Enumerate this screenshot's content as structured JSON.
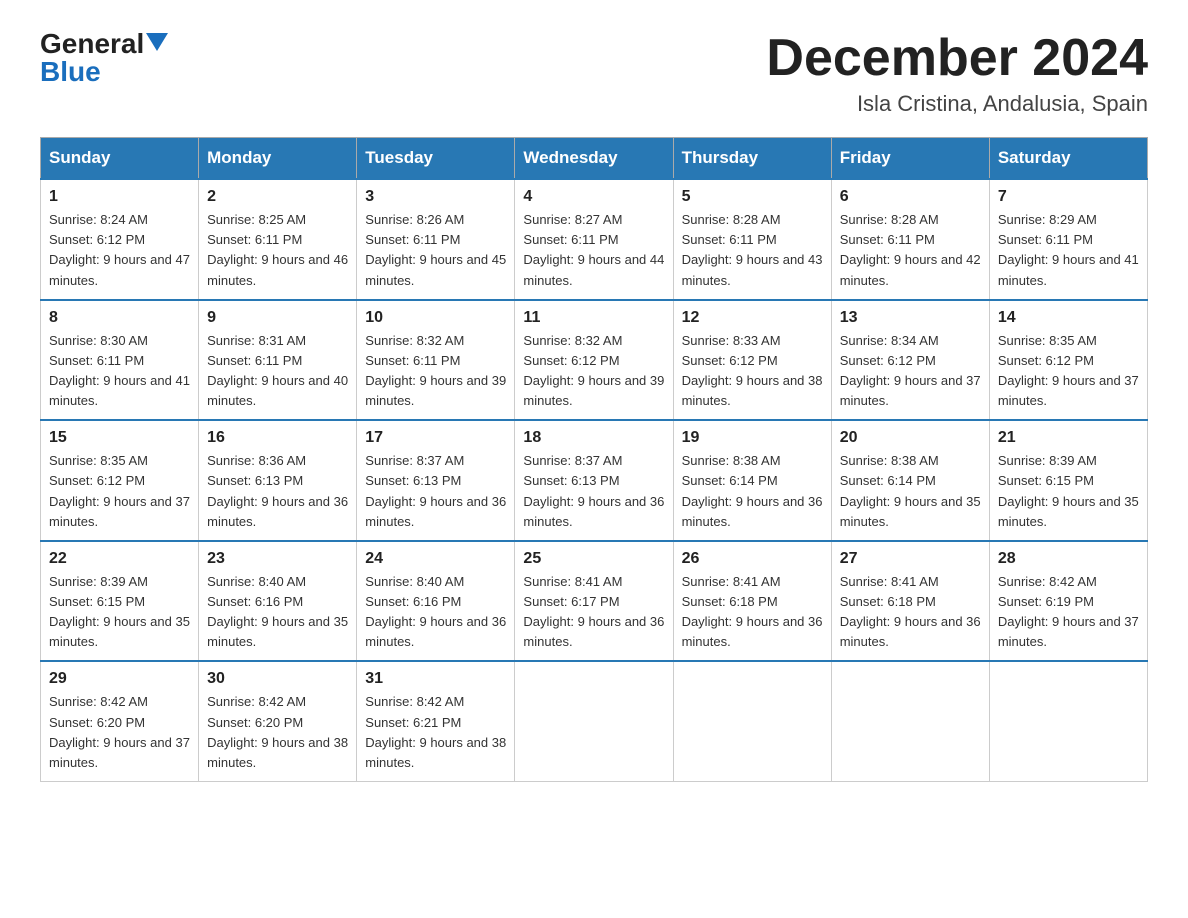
{
  "header": {
    "logo_general": "General",
    "logo_blue": "Blue",
    "month_title": "December 2024",
    "subtitle": "Isla Cristina, Andalusia, Spain"
  },
  "days_of_week": [
    "Sunday",
    "Monday",
    "Tuesday",
    "Wednesday",
    "Thursday",
    "Friday",
    "Saturday"
  ],
  "weeks": [
    [
      {
        "day": "1",
        "sunrise": "8:24 AM",
        "sunset": "6:12 PM",
        "daylight": "9 hours and 47 minutes."
      },
      {
        "day": "2",
        "sunrise": "8:25 AM",
        "sunset": "6:11 PM",
        "daylight": "9 hours and 46 minutes."
      },
      {
        "day": "3",
        "sunrise": "8:26 AM",
        "sunset": "6:11 PM",
        "daylight": "9 hours and 45 minutes."
      },
      {
        "day": "4",
        "sunrise": "8:27 AM",
        "sunset": "6:11 PM",
        "daylight": "9 hours and 44 minutes."
      },
      {
        "day": "5",
        "sunrise": "8:28 AM",
        "sunset": "6:11 PM",
        "daylight": "9 hours and 43 minutes."
      },
      {
        "day": "6",
        "sunrise": "8:28 AM",
        "sunset": "6:11 PM",
        "daylight": "9 hours and 42 minutes."
      },
      {
        "day": "7",
        "sunrise": "8:29 AM",
        "sunset": "6:11 PM",
        "daylight": "9 hours and 41 minutes."
      }
    ],
    [
      {
        "day": "8",
        "sunrise": "8:30 AM",
        "sunset": "6:11 PM",
        "daylight": "9 hours and 41 minutes."
      },
      {
        "day": "9",
        "sunrise": "8:31 AM",
        "sunset": "6:11 PM",
        "daylight": "9 hours and 40 minutes."
      },
      {
        "day": "10",
        "sunrise": "8:32 AM",
        "sunset": "6:11 PM",
        "daylight": "9 hours and 39 minutes."
      },
      {
        "day": "11",
        "sunrise": "8:32 AM",
        "sunset": "6:12 PM",
        "daylight": "9 hours and 39 minutes."
      },
      {
        "day": "12",
        "sunrise": "8:33 AM",
        "sunset": "6:12 PM",
        "daylight": "9 hours and 38 minutes."
      },
      {
        "day": "13",
        "sunrise": "8:34 AM",
        "sunset": "6:12 PM",
        "daylight": "9 hours and 37 minutes."
      },
      {
        "day": "14",
        "sunrise": "8:35 AM",
        "sunset": "6:12 PM",
        "daylight": "9 hours and 37 minutes."
      }
    ],
    [
      {
        "day": "15",
        "sunrise": "8:35 AM",
        "sunset": "6:12 PM",
        "daylight": "9 hours and 37 minutes."
      },
      {
        "day": "16",
        "sunrise": "8:36 AM",
        "sunset": "6:13 PM",
        "daylight": "9 hours and 36 minutes."
      },
      {
        "day": "17",
        "sunrise": "8:37 AM",
        "sunset": "6:13 PM",
        "daylight": "9 hours and 36 minutes."
      },
      {
        "day": "18",
        "sunrise": "8:37 AM",
        "sunset": "6:13 PM",
        "daylight": "9 hours and 36 minutes."
      },
      {
        "day": "19",
        "sunrise": "8:38 AM",
        "sunset": "6:14 PM",
        "daylight": "9 hours and 36 minutes."
      },
      {
        "day": "20",
        "sunrise": "8:38 AM",
        "sunset": "6:14 PM",
        "daylight": "9 hours and 35 minutes."
      },
      {
        "day": "21",
        "sunrise": "8:39 AM",
        "sunset": "6:15 PM",
        "daylight": "9 hours and 35 minutes."
      }
    ],
    [
      {
        "day": "22",
        "sunrise": "8:39 AM",
        "sunset": "6:15 PM",
        "daylight": "9 hours and 35 minutes."
      },
      {
        "day": "23",
        "sunrise": "8:40 AM",
        "sunset": "6:16 PM",
        "daylight": "9 hours and 35 minutes."
      },
      {
        "day": "24",
        "sunrise": "8:40 AM",
        "sunset": "6:16 PM",
        "daylight": "9 hours and 36 minutes."
      },
      {
        "day": "25",
        "sunrise": "8:41 AM",
        "sunset": "6:17 PM",
        "daylight": "9 hours and 36 minutes."
      },
      {
        "day": "26",
        "sunrise": "8:41 AM",
        "sunset": "6:18 PM",
        "daylight": "9 hours and 36 minutes."
      },
      {
        "day": "27",
        "sunrise": "8:41 AM",
        "sunset": "6:18 PM",
        "daylight": "9 hours and 36 minutes."
      },
      {
        "day": "28",
        "sunrise": "8:42 AM",
        "sunset": "6:19 PM",
        "daylight": "9 hours and 37 minutes."
      }
    ],
    [
      {
        "day": "29",
        "sunrise": "8:42 AM",
        "sunset": "6:20 PM",
        "daylight": "9 hours and 37 minutes."
      },
      {
        "day": "30",
        "sunrise": "8:42 AM",
        "sunset": "6:20 PM",
        "daylight": "9 hours and 38 minutes."
      },
      {
        "day": "31",
        "sunrise": "8:42 AM",
        "sunset": "6:21 PM",
        "daylight": "9 hours and 38 minutes."
      },
      null,
      null,
      null,
      null
    ]
  ],
  "labels": {
    "sunrise": "Sunrise:",
    "sunset": "Sunset:",
    "daylight": "Daylight:"
  }
}
